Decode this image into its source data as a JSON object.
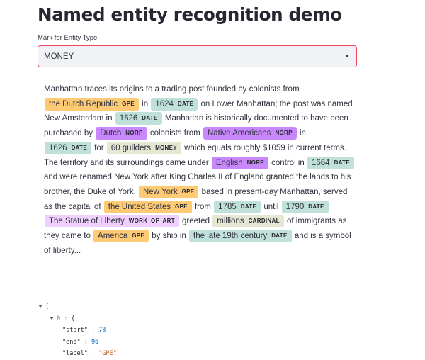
{
  "page": {
    "title": "Named entity recognition demo"
  },
  "select": {
    "label": "Mark for Entity Type",
    "value": "MONEY"
  },
  "ner": {
    "segments": [
      {
        "t": "Manhattan traces its origins to a trading post founded by colonists from "
      },
      {
        "t": "the Dutch Republic",
        "label": "GPE"
      },
      {
        "t": " in "
      },
      {
        "t": "1624",
        "label": "DATE"
      },
      {
        "t": " on Lower Manhattan; the post was named New Amsterdam in "
      },
      {
        "t": "1626",
        "label": "DATE"
      },
      {
        "t": " Manhattan is historically documented to have been purchased by "
      },
      {
        "t": "Dutch",
        "label": "NORP"
      },
      {
        "t": " colonists from "
      },
      {
        "t": "Native Americans",
        "label": "NORP"
      },
      {
        "t": " in "
      },
      {
        "t": "1626",
        "label": "DATE"
      },
      {
        "t": " for "
      },
      {
        "t": "60 guilders",
        "label": "MONEY"
      },
      {
        "t": " which equals roughly $1059 in current terms. The territory and its surroundings came under "
      },
      {
        "t": "English",
        "label": "NORP"
      },
      {
        "t": " control in "
      },
      {
        "t": "1664",
        "label": "DATE"
      },
      {
        "t": " and were renamed New York after King Charles II of England granted the lands to his brother, the Duke of York. "
      },
      {
        "t": "New York",
        "label": "GPE"
      },
      {
        "t": " based in present-day Manhattan, served as the capital of "
      },
      {
        "t": "the United States",
        "label": "GPE"
      },
      {
        "t": " from "
      },
      {
        "t": "1785",
        "label": "DATE"
      },
      {
        "t": " until "
      },
      {
        "t": "1790",
        "label": "DATE"
      },
      {
        "t": " "
      },
      {
        "t": "The Statue of Liberty",
        "label": "WORK_OF_ART"
      },
      {
        "t": " greeted "
      },
      {
        "t": "millions",
        "label": "CARDINAL"
      },
      {
        "t": " of immigrants as they came to "
      },
      {
        "t": "America",
        "label": "GPE"
      },
      {
        "t": " by ship in "
      },
      {
        "t": "the late 19th century",
        "label": "DATE"
      },
      {
        "t": " and is a symbol of liberty... "
      }
    ]
  },
  "json_view": {
    "open_bracket": "[",
    "item_index": "0 :",
    "item_open": "{",
    "start_key": "\"start\"",
    "start_val": "78",
    "end_key": "\"end\"",
    "end_val": "96",
    "label_key": "\"label\"",
    "label_val": "\"GPE\""
  }
}
